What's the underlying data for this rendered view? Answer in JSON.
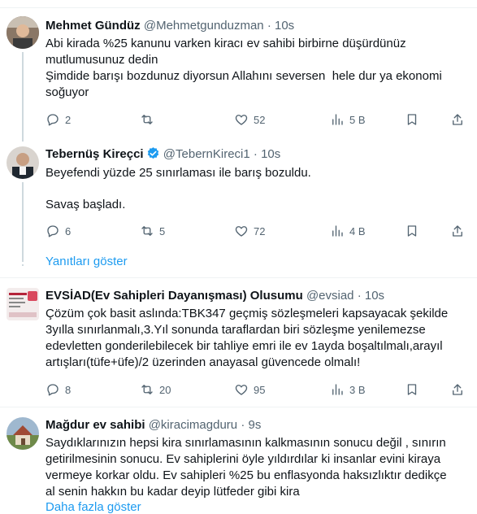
{
  "tweets": [
    {
      "name": "Mehmet Gündüz",
      "handle": "@Mehmetgunduzman",
      "sep": "·",
      "time": "10s",
      "lines": [
        "Abi kirada %25 kanunu varken kiracı ev sahibi birbirne düşürdünüz",
        "mutlumusunuz dedin",
        "Şimdide barışı bozdunuz diyorsun Allahını seversen  hele dur ya ekonomi",
        "soğuyor"
      ],
      "replies": "2",
      "retweets": "",
      "likes": "52",
      "views": "5 B"
    },
    {
      "name": "Tebernüş Kireçci",
      "handle": "@TebernKireci1",
      "sep": "·",
      "time": "10s",
      "lines": [
        "Beyefendi yüzde 25 sınırlaması ile barış bozuldu.",
        "",
        "Savaş başladı."
      ],
      "replies": "6",
      "retweets": "5",
      "likes": "72",
      "views": "4 B"
    },
    {
      "name": "EVSİAD(Ev Sahipleri Dayanışması) Olusumu",
      "handle": "@evsiad",
      "sep": "·",
      "time": "10s",
      "lines": [
        "Çözüm çok basit aslında:TBK347 geçmiş sözleşmeleri kapsayacak şekilde",
        "3yılla sınırlanmalı,3.Yıl sonunda taraflardan biri sözleşme yenilemezse",
        "edevletten gonderilebilecek bir tahliye emri ile ev 1ayda boşaltılmalı,arayıl",
        "artışları(tüfe+üfe)/2 üzerinden anayasal güvencede olmalı!"
      ],
      "replies": "8",
      "retweets": "20",
      "likes": "95",
      "views": "3 B"
    },
    {
      "name": "Mağdur ev sahibi",
      "handle": "@kiracimagduru",
      "sep": "·",
      "time": "9s",
      "lines": [
        "Saydıklarınızın hepsi kira sınırlamasının kalkmasının sonucu değil , sınırın",
        "getirilmesinin sonucu. Ev sahiplerini öyle yıldırdılar ki insanlar evini kiraya",
        "vermeye korkar oldu. Ev sahipleri %25 bu enflasyonda haksızlıktır dedikçe",
        "al senin hakkın bu kadar deyip lütfeder gibi kira"
      ]
    }
  ],
  "show_replies": "Yanıtları göster",
  "show_more": "Daha fazla göster",
  "colors": {
    "link": "#1d9bf0",
    "verified": "#1d9bf0",
    "muted": "#536471"
  }
}
